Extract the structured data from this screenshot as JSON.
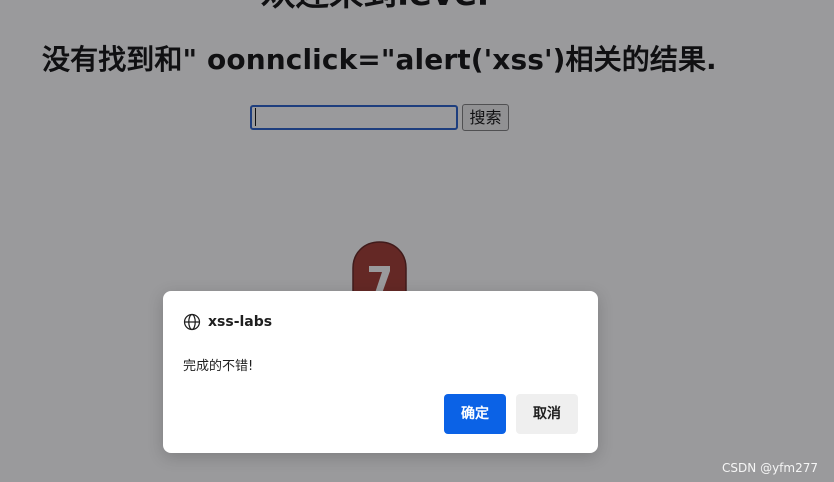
{
  "page": {
    "level_heading": "欢迎来到level",
    "result_text": "没有找到和\" oonnclick=\"alert('xss')相关的结果.",
    "search_input_value": "",
    "search_button_label": "搜索",
    "badge_icon": "level-7-badge-image"
  },
  "dialog": {
    "origin": "xss-labs",
    "origin_icon": "globe-icon",
    "message": "完成的不错!",
    "ok_label": "确定",
    "cancel_label": "取消"
  },
  "watermark": "CSDN @yfm277",
  "colors": {
    "overlay": "#222228",
    "ok_button": "#0b62e6",
    "cancel_button": "#efefef",
    "badge": "#9b2d24"
  }
}
